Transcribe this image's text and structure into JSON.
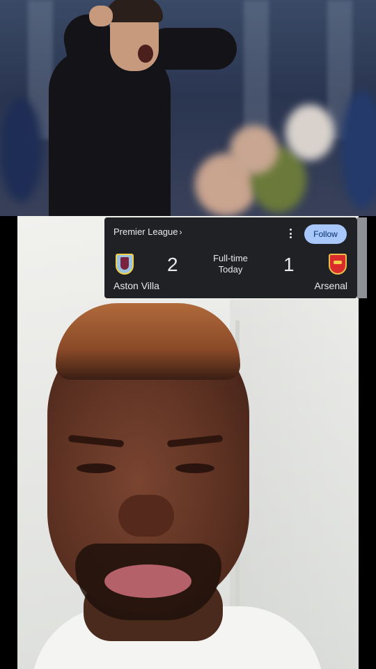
{
  "score_card": {
    "league": "Premier League",
    "league_chevron": "›",
    "follow_label": "Follow",
    "status_line1": "Full-time",
    "status_line2": "Today",
    "home": {
      "name": "Aston Villa",
      "score": "2",
      "crest": "aston-villa-crest",
      "color": "#9bc4e0"
    },
    "away": {
      "name": "Arsenal",
      "score": "1",
      "crest": "arsenal-crest",
      "color": "#db2c2c"
    },
    "colors": {
      "card_bg": "#1f2125",
      "follow_bg": "#a8c7fa",
      "follow_text": "#062e6f"
    }
  },
  "media": {
    "top_image": "coach-reaction-photo",
    "bottom_image": "person-selfie-video"
  }
}
